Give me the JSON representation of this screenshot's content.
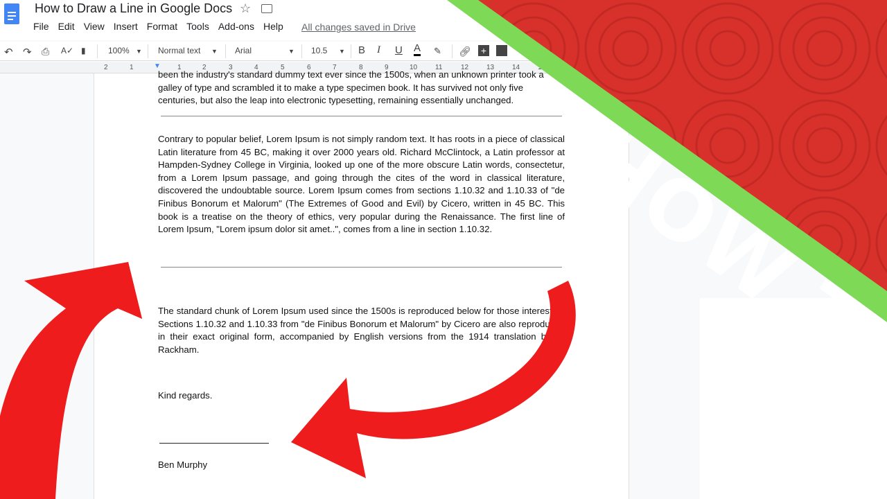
{
  "doc": {
    "title": "How to Draw a Line in Google Docs",
    "saved_status": "All changes saved in Drive"
  },
  "menu": [
    "File",
    "Edit",
    "View",
    "Insert",
    "Format",
    "Tools",
    "Add-ons",
    "Help"
  ],
  "toolbar": {
    "zoom": "100%",
    "style": "Normal text",
    "font": "Arial",
    "size": "10.5",
    "bold": "B",
    "italic": "I",
    "underline": "U",
    "text_color": "A"
  },
  "ruler": [
    "2",
    "1",
    "1",
    "2",
    "3",
    "4",
    "5",
    "6",
    "7",
    "8",
    "9",
    "10",
    "11",
    "12",
    "13",
    "14",
    "15"
  ],
  "body": {
    "p1": "been the industry's standard dummy text ever since the 1500s, when an unknown printer took a galley of type and scrambled it to make a type specimen book. It has survived not only five centuries, but also the leap into electronic typesetting, remaining essentially unchanged.",
    "p2": "Contrary to popular belief, Lorem Ipsum is not simply random text. It has roots in a piece of classical Latin literature from 45 BC, making it over 2000 years old. Richard McClintock, a Latin professor at Hampden-Sydney College in Virginia, looked up one of the more obscure Latin words, consectetur, from a Lorem Ipsum passage, and going through the cites of the word in classical literature, discovered the undoubtable source. Lorem Ipsum comes from sections 1.10.32 and 1.10.33 of \"de Finibus Bonorum et Malorum\" (The Extremes of Good and Evil) by Cicero, written in 45 BC. This book is a treatise on the theory of ethics, very popular during the Renaissance. The first line of Lorem Ipsum, \"Lorem ipsum dolor sit amet..\", comes from a line in section 1.10.32.",
    "p3": "The standard chunk of Lorem Ipsum used since the 1500s is reproduced below for those interested. Sections 1.10.32 and 1.10.33 from \"de Finibus Bonorum et Malorum\" by Cicero are also reproduced in their exact original form, accompanied by English versions from the 1914 translation by H. Rackham.",
    "closing": "Kind regards.",
    "signature": "Ben Murphy"
  },
  "banner": {
    "text": "HOW TO",
    "stripe_color": "#7ed957",
    "bg_color": "#d8312b",
    "arrow_color": "#ee1c1c"
  }
}
